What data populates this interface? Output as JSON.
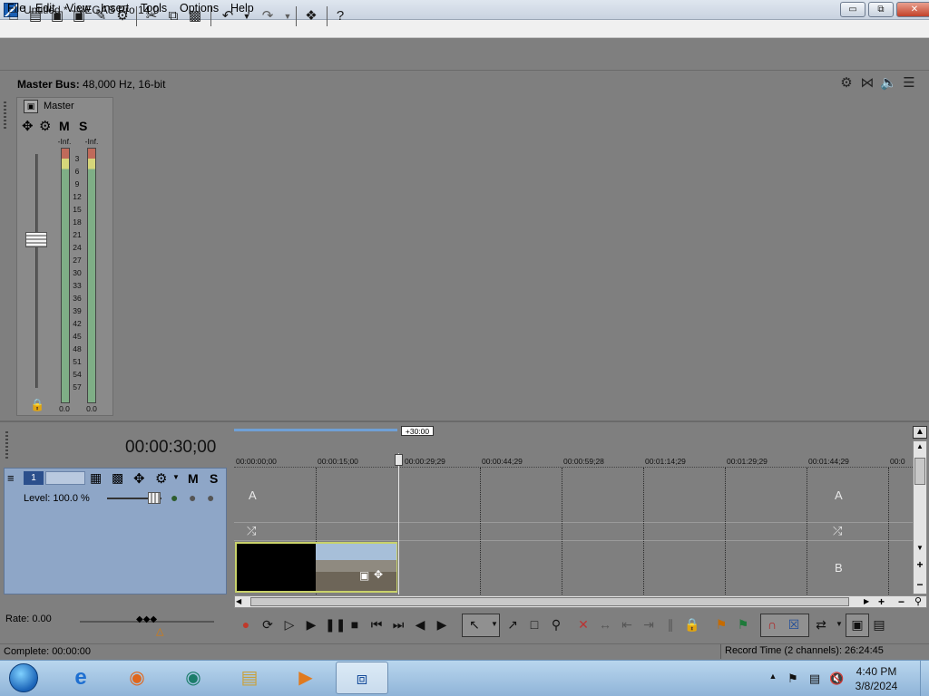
{
  "window": {
    "title": "Untitled * - VEGAS Pro 14.0",
    "minimize_glyph": "▭",
    "restore_glyph": "⧉",
    "close_glyph": "✕"
  },
  "menu": [
    "File",
    "Edit",
    "View",
    "Insert",
    "Tools",
    "Options",
    "Help"
  ],
  "toolbar_icons": [
    "new-icon",
    "open-icon",
    "save-icon",
    "save-as-icon",
    "render-icon",
    "properties-icon",
    "cut-icon",
    "copy-icon",
    "paste-icon",
    "undo-icon",
    "redo-icon",
    "plugin-icon",
    "help-icon"
  ],
  "mixer": {
    "title_bold": "Master Bus:",
    "title_rest": " 48,000 Hz, 16-bit",
    "strip_name": "Master",
    "mute": "M",
    "solo": "S",
    "peak_left": "-Inf.",
    "peak_right": "-Inf.",
    "meter_scale": [
      "3",
      "6",
      "9",
      "12",
      "15",
      "18",
      "21",
      "24",
      "27",
      "30",
      "33",
      "36",
      "39",
      "42",
      "45",
      "48",
      "51",
      "54",
      "57"
    ],
    "level_left": "0.0",
    "level_right": "0.0"
  },
  "timeline": {
    "time_display": "00:00:30;00",
    "loop_region": "+30:00",
    "ruler_ticks": [
      "00:00:00;00",
      "00:00:15;00",
      "00:00:29;29",
      "00:00:44;29",
      "00:00:59;28",
      "00:01:14;29",
      "00:01:29;29",
      "00:01:44;29",
      "00:0"
    ],
    "track": {
      "number": "1",
      "level": "Level: 100.0 %",
      "mute": "M",
      "solo": "S"
    },
    "lane_labels": {
      "a": "A",
      "b": "B",
      "a_right": "A",
      "b_right": "B"
    }
  },
  "transport": {
    "rate": "Rate: 0.00"
  },
  "status": {
    "left": "Complete: 00:00:00",
    "right": "Record Time (2 channels): 26:24:45"
  },
  "taskbar": {
    "time": "4:40 PM",
    "date": "3/8/2024"
  }
}
